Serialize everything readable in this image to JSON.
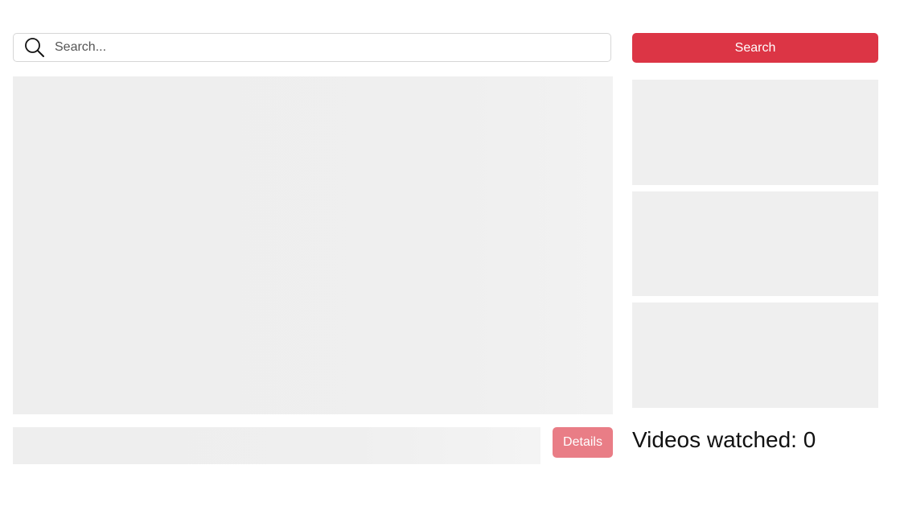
{
  "search": {
    "placeholder": "Search...",
    "value": "",
    "button_label": "Search"
  },
  "player": {
    "details_label": "Details"
  },
  "sidebar": {
    "thumbnails": 3
  },
  "stats": {
    "videos_watched_label": "Videos watched:",
    "videos_watched_count": "0"
  },
  "colors": {
    "accent": "#dc3545",
    "accent_muted": "#e97d86",
    "placeholder_bg": "#efefef"
  }
}
